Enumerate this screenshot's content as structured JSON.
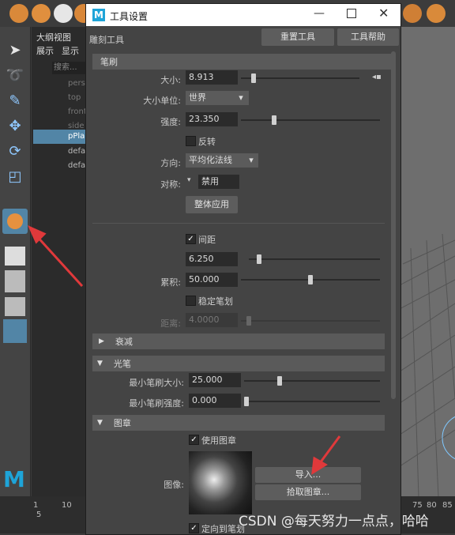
{
  "colors": {
    "accent": "#5285a6",
    "dialog_bg": "#444444",
    "section_header": "#5a5a5a",
    "arrow": "#e0393b"
  },
  "outliner": {
    "tab_label": "大纲视图",
    "menu": [
      "展示",
      "显示"
    ],
    "search_placeholder": "搜索...",
    "items": [
      "pers",
      "top",
      "front",
      "side",
      "pPla",
      "defa",
      "defa"
    ]
  },
  "timeline": {
    "ticks": [
      "1",
      "5",
      "10",
      "75",
      "80",
      "85"
    ]
  },
  "dialog": {
    "title": "工具设置",
    "tool_name": "雕刻工具",
    "reset_label": "重置工具",
    "help_label": "工具帮助",
    "brush": {
      "header": "笔刷",
      "size_label": "大小:",
      "size_value": "8.913",
      "size_fraction": 0.09,
      "unit_label": "大小单位:",
      "unit_value": "世界",
      "strength_label": "强度:",
      "strength_value": "23.350",
      "strength_fraction": 0.23,
      "invert_label": "反转",
      "invert_checked": false,
      "direction_label": "方向:",
      "direction_value": "平均化法线",
      "symmetry_label": "对称:",
      "symmetry_value": "禁用",
      "apply_label": "整体应用",
      "spacing_label": "间距",
      "spacing_checked": true,
      "spacing_value": "6.250",
      "spacing_fraction": 0.06,
      "buildup_label": "累积:",
      "buildup_value": "50.000",
      "buildup_fraction": 0.5,
      "stabilize_label": "稳定笔划",
      "stabilize_checked": false,
      "distance_label": "距离:",
      "distance_value": "4.0000",
      "distance_fraction": 0.04
    },
    "falloff": {
      "header": "衰减"
    },
    "stylus": {
      "header": "光笔",
      "min_size_label": "最小笔刷大小:",
      "min_size_value": "25.000",
      "min_size_fraction": 0.25,
      "min_strength_label": "最小笔刷强度:",
      "min_strength_value": "0.000",
      "min_strength_fraction": 0.0
    },
    "stamp": {
      "header": "图章",
      "use_label": "使用图章",
      "use_checked": true,
      "image_label": "图像:",
      "import_label": "导入...",
      "pick_label": "拾取图章...",
      "orient_label": "定向到笔划",
      "orient_checked": true
    }
  },
  "watermark": "CSDN @每天努力一点点，哈哈"
}
